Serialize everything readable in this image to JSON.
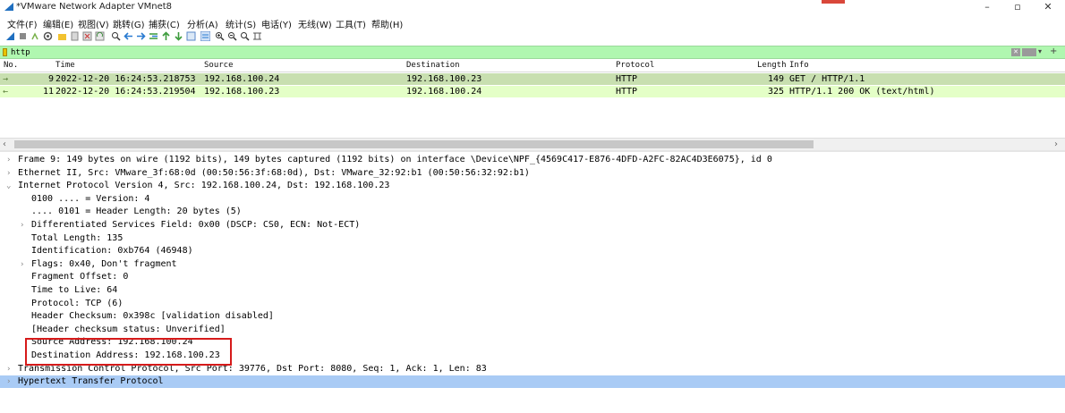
{
  "window": {
    "title": "*VMware Network Adapter VMnet8",
    "controls": {
      "minimize": "–",
      "maximize": "▫",
      "close": "✕"
    }
  },
  "menu": [
    "文件(F)",
    "编辑(E)",
    "视图(V)",
    "跳转(G)",
    "捕获(C)",
    "分析(A)",
    "统计(S)",
    "电话(Y)",
    "无线(W)",
    "工具(T)",
    "帮助(H)"
  ],
  "filter": {
    "value": "http",
    "clear_label": "✕"
  },
  "packet_list": {
    "columns": [
      "No.",
      "Time",
      "Source",
      "Destination",
      "Protocol",
      "Length",
      "Info"
    ],
    "rows": [
      {
        "no": "9",
        "time": "2022-12-20 16:24:53.218753",
        "source": "192.168.100.24",
        "destination": "192.168.100.23",
        "protocol": "HTTP",
        "length": "149",
        "info": "GET / HTTP/1.1",
        "arrow": "→"
      },
      {
        "no": "11",
        "time": "2022-12-20 16:24:53.219504",
        "source": "192.168.100.23",
        "destination": "192.168.100.24",
        "protocol": "HTTP",
        "length": "325",
        "info": "HTTP/1.1 200 OK  (text/html)",
        "arrow": "←"
      }
    ]
  },
  "details": [
    {
      "toggle": "›",
      "indent": 0,
      "text": "Frame 9: 149 bytes on wire (1192 bits), 149 bytes captured (1192 bits) on interface \\Device\\NPF_{4569C417-E876-4DFD-A2FC-82AC4D3E6075}, id 0"
    },
    {
      "toggle": "›",
      "indent": 0,
      "text": "Ethernet II, Src: VMware_3f:68:0d (00:50:56:3f:68:0d), Dst: VMware_32:92:b1 (00:50:56:32:92:b1)"
    },
    {
      "toggle": "⌄",
      "indent": 0,
      "text": "Internet Protocol Version 4, Src: 192.168.100.24, Dst: 192.168.100.23"
    },
    {
      "toggle": "",
      "indent": 1,
      "text": "0100 .... = Version: 4"
    },
    {
      "toggle": "",
      "indent": 1,
      "text": ".... 0101 = Header Length: 20 bytes (5)"
    },
    {
      "toggle": "›",
      "indent": 1,
      "text": "Differentiated Services Field: 0x00 (DSCP: CS0, ECN: Not-ECT)"
    },
    {
      "toggle": "",
      "indent": 1,
      "text": "Total Length: 135"
    },
    {
      "toggle": "",
      "indent": 1,
      "text": "Identification: 0xb764 (46948)"
    },
    {
      "toggle": "›",
      "indent": 1,
      "text": "Flags: 0x40, Don't fragment"
    },
    {
      "toggle": "",
      "indent": 1,
      "text": "Fragment Offset: 0"
    },
    {
      "toggle": "",
      "indent": 1,
      "text": "Time to Live: 64"
    },
    {
      "toggle": "",
      "indent": 1,
      "text": "Protocol: TCP (6)"
    },
    {
      "toggle": "",
      "indent": 1,
      "text": "Header Checksum: 0x398c [validation disabled]"
    },
    {
      "toggle": "",
      "indent": 1,
      "text": "[Header checksum status: Unverified]"
    },
    {
      "toggle": "",
      "indent": 1,
      "text": "Source Address: 192.168.100.24"
    },
    {
      "toggle": "",
      "indent": 1,
      "text": "Destination Address: 192.168.100.23"
    },
    {
      "toggle": "›",
      "indent": 0,
      "text": "Transmission Control Protocol, Src Port: 39776, Dst Port: 8080, Seq: 1, Ack: 1, Len: 83"
    },
    {
      "toggle": "›",
      "indent": 0,
      "text": "Hypertext Transfer Protocol",
      "selected": true
    }
  ],
  "colors": {
    "filter_bg": "#b0f7b0",
    "http_row": "#e4ffc7",
    "selected_detail": "#a9cbf5",
    "annotation": "#d61a1a"
  }
}
